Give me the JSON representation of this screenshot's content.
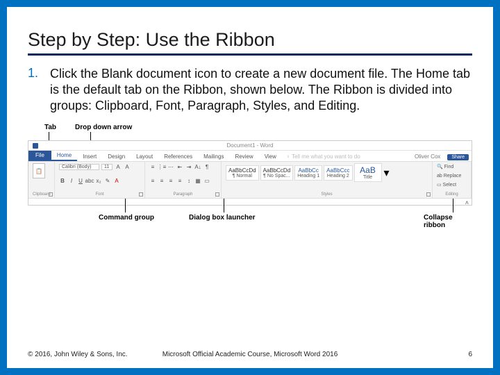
{
  "slide": {
    "title": "Step by Step: Use the Ribbon",
    "list_number": "1.",
    "list_text": "Click the Blank document icon to create a new document file. The Home tab is the default tab on the Ribbon, shown below. The Ribbon is divided into groups: Clipboard, Font, Paragraph, Styles, and Editing."
  },
  "callouts": {
    "tab": "Tab",
    "dropdown": "Drop down arrow",
    "command_group": "Command group",
    "dialog_launcher": "Dialog box launcher",
    "collapse": "Collapse ribbon"
  },
  "ribbon": {
    "doc_title": "Document1 - Word",
    "tabs": {
      "file": "File",
      "home": "Home",
      "insert": "Insert",
      "design": "Design",
      "layout": "Layout",
      "references": "References",
      "mailings": "Mailings",
      "review": "Review",
      "view": "View",
      "tellme": "♀ Tell me what you want to do"
    },
    "user": "Oliver Cox",
    "share": "Share",
    "groups": {
      "clipboard": {
        "label": "Clipboard",
        "paste": "📋"
      },
      "font": {
        "label": "Font",
        "name": "Calibri (Body)",
        "size": "11"
      },
      "paragraph": {
        "label": "Paragraph"
      },
      "styles": {
        "label": "Styles",
        "items": [
          {
            "preview": "AaBbCcDd",
            "name": "¶ Normal"
          },
          {
            "preview": "AaBbCcDd",
            "name": "¶ No Spac..."
          },
          {
            "preview": "AaBbCc",
            "name": "Heading 1"
          },
          {
            "preview": "AaBbCcc",
            "name": "Heading 2"
          },
          {
            "preview": "AaB",
            "name": "Title"
          }
        ]
      },
      "editing": {
        "label": "Editing",
        "find": "🔍 Find",
        "replace": "ab Replace",
        "select": "▭ Select"
      }
    }
  },
  "footer": {
    "left": "© 2016, John Wiley & Sons, Inc.",
    "center": "Microsoft Official Academic Course, Microsoft Word 2016",
    "right": "6"
  }
}
